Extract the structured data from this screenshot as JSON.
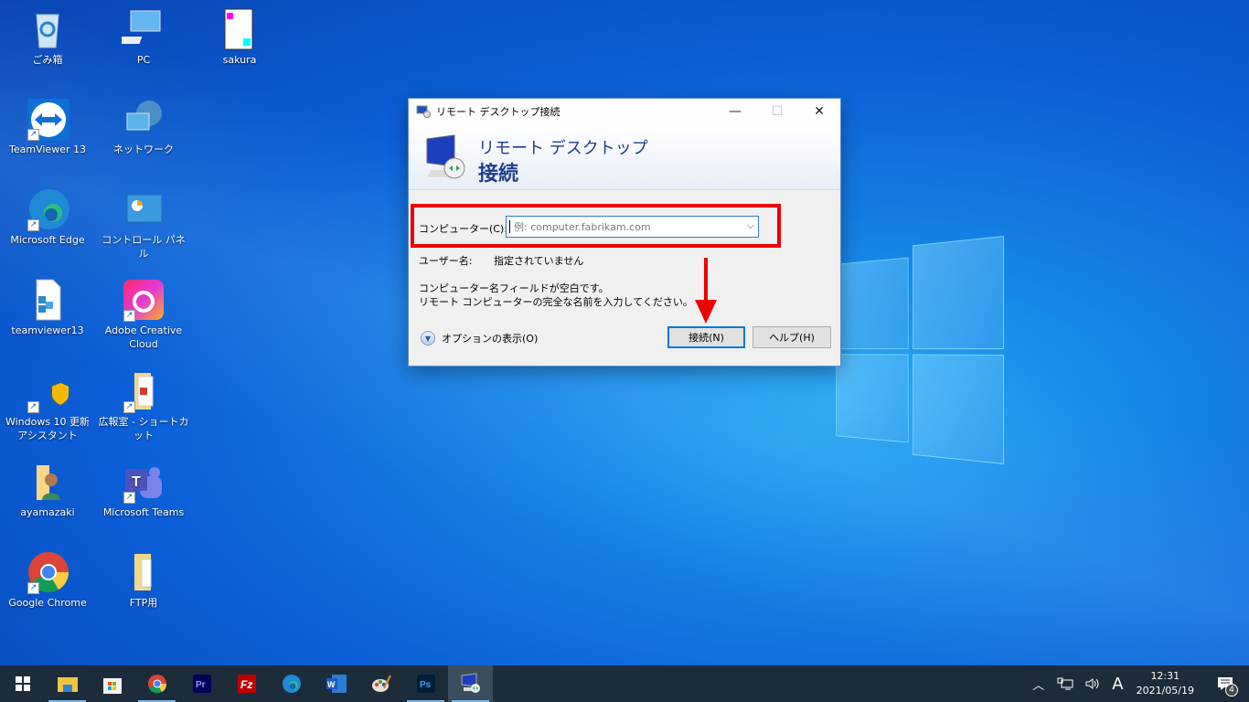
{
  "desktop": {
    "icons": [
      {
        "label": "ごみ箱",
        "icon": "recycle-bin-icon"
      },
      {
        "label": "PC",
        "icon": "pc-icon"
      },
      {
        "label": "sakura",
        "icon": "sakura-editor-icon"
      },
      {
        "label": "TeamViewer 13",
        "icon": "teamviewer-icon"
      },
      {
        "label": "ネットワーク",
        "icon": "network-icon"
      },
      {
        "label": "Microsoft Edge",
        "icon": "edge-icon"
      },
      {
        "label": "コントロール パネル",
        "icon": "control-panel-icon"
      },
      {
        "label": "teamviewer13",
        "icon": "registry-file-icon"
      },
      {
        "label": "Adobe Creative Cloud",
        "icon": "creative-cloud-icon"
      },
      {
        "label": "Windows 10 更新アシスタント",
        "icon": "windows-update-assistant-icon"
      },
      {
        "label": "広報室 - ショートカット",
        "icon": "folder-shortcut-icon"
      },
      {
        "label": "ayamazaki",
        "icon": "user-folder-icon"
      },
      {
        "label": "Microsoft Teams",
        "icon": "teams-icon"
      },
      {
        "label": "Google Chrome",
        "icon": "chrome-icon"
      },
      {
        "label": "FTP用",
        "icon": "folder-icon"
      }
    ]
  },
  "dialog": {
    "title": "リモート デスクトップ接続",
    "banner_line1": "リモート デスクトップ",
    "banner_line2": "接続",
    "computer_label": "コンピューター(C):",
    "computer_placeholder": "例: computer.fabrikam.com",
    "computer_value": "",
    "user_label": "ユーザー名:",
    "user_value": "指定されていません",
    "message_line1": "コンピューター名フィールドが空白です。",
    "message_line2": "リモート コンピューターの完全な名前を入力してください。",
    "options_label": "オプションの表示(O)",
    "connect_label": "接続(N)",
    "help_label": "ヘルプ(H)",
    "minimize": "—",
    "maximize": "☐",
    "close": "✕"
  },
  "annotation": {
    "highlight_color": "#ee0000"
  },
  "taskbar": {
    "apps": [
      "start",
      "file-explorer",
      "microsoft-store",
      "chrome",
      "premiere-pro",
      "filezilla",
      "edge",
      "word",
      "paint",
      "photoshop",
      "remote-desktop"
    ],
    "tray": {
      "ime": "A",
      "time": "12:31",
      "date": "2021/05/19",
      "notifications": "4"
    }
  }
}
